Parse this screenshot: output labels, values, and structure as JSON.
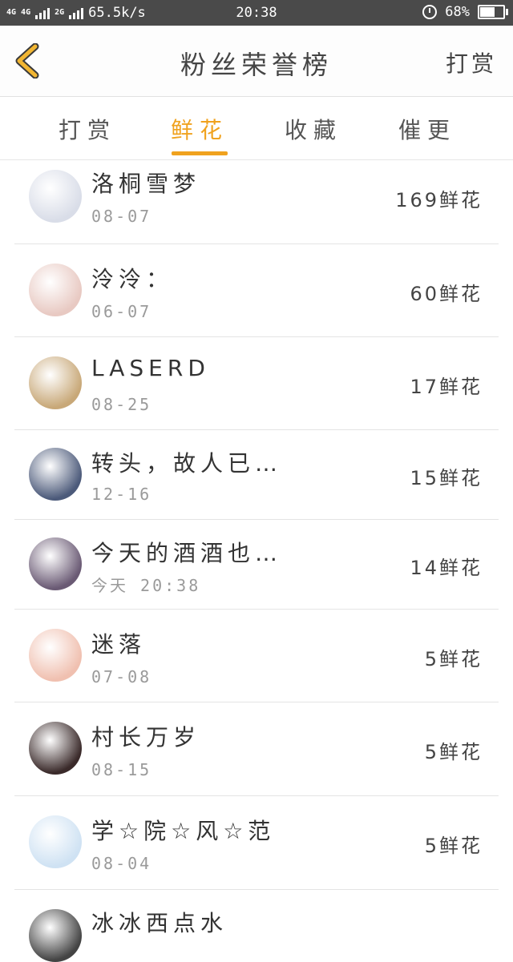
{
  "status_bar": {
    "network_left": "4G",
    "network_left_2": "4G",
    "network_right": "2G",
    "speed": "65.5k/s",
    "time": "20:38",
    "battery": "68%",
    "battery_level": 0.68
  },
  "header": {
    "title": "粉丝荣誉榜",
    "action": "打赏",
    "back_icon": "chevron-left-icon"
  },
  "tabs": [
    {
      "label": "打赏",
      "active": false
    },
    {
      "label": "鲜花",
      "active": true
    },
    {
      "label": "收藏",
      "active": false
    },
    {
      "label": "催更",
      "active": false
    }
  ],
  "accent_color": "#f0a21e",
  "fans": [
    {
      "name": "洛桐雪梦",
      "date": "08-07",
      "count": "169鲜花",
      "avatar_color": "#d9dde8"
    },
    {
      "name": "泠泠：",
      "date": "06-07",
      "count": "60鲜花",
      "avatar_color": "#e8c9c2"
    },
    {
      "name": "LASERD",
      "date": "08-25",
      "count": "17鲜花",
      "avatar_color": "#c8a878"
    },
    {
      "name": "转头，故人已…",
      "date": "12-16",
      "count": "15鲜花",
      "avatar_color": "#4c5a7a"
    },
    {
      "name": "今天的酒酒也…",
      "date": "今天 20:38",
      "count": "14鲜花",
      "avatar_color": "#6a5a74"
    },
    {
      "name": "迷落",
      "date": "07-08",
      "count": "5鲜花",
      "avatar_color": "#f0c0b0"
    },
    {
      "name": "村长万岁",
      "date": "08-15",
      "count": "5鲜花",
      "avatar_color": "#3a2a2a"
    },
    {
      "name": "学☆院☆风☆范",
      "date": "08-04",
      "count": "5鲜花",
      "avatar_color": "#cfe2f3"
    },
    {
      "name": "冰冰西点水",
      "date": "",
      "count": "",
      "avatar_color": "#444444"
    }
  ]
}
